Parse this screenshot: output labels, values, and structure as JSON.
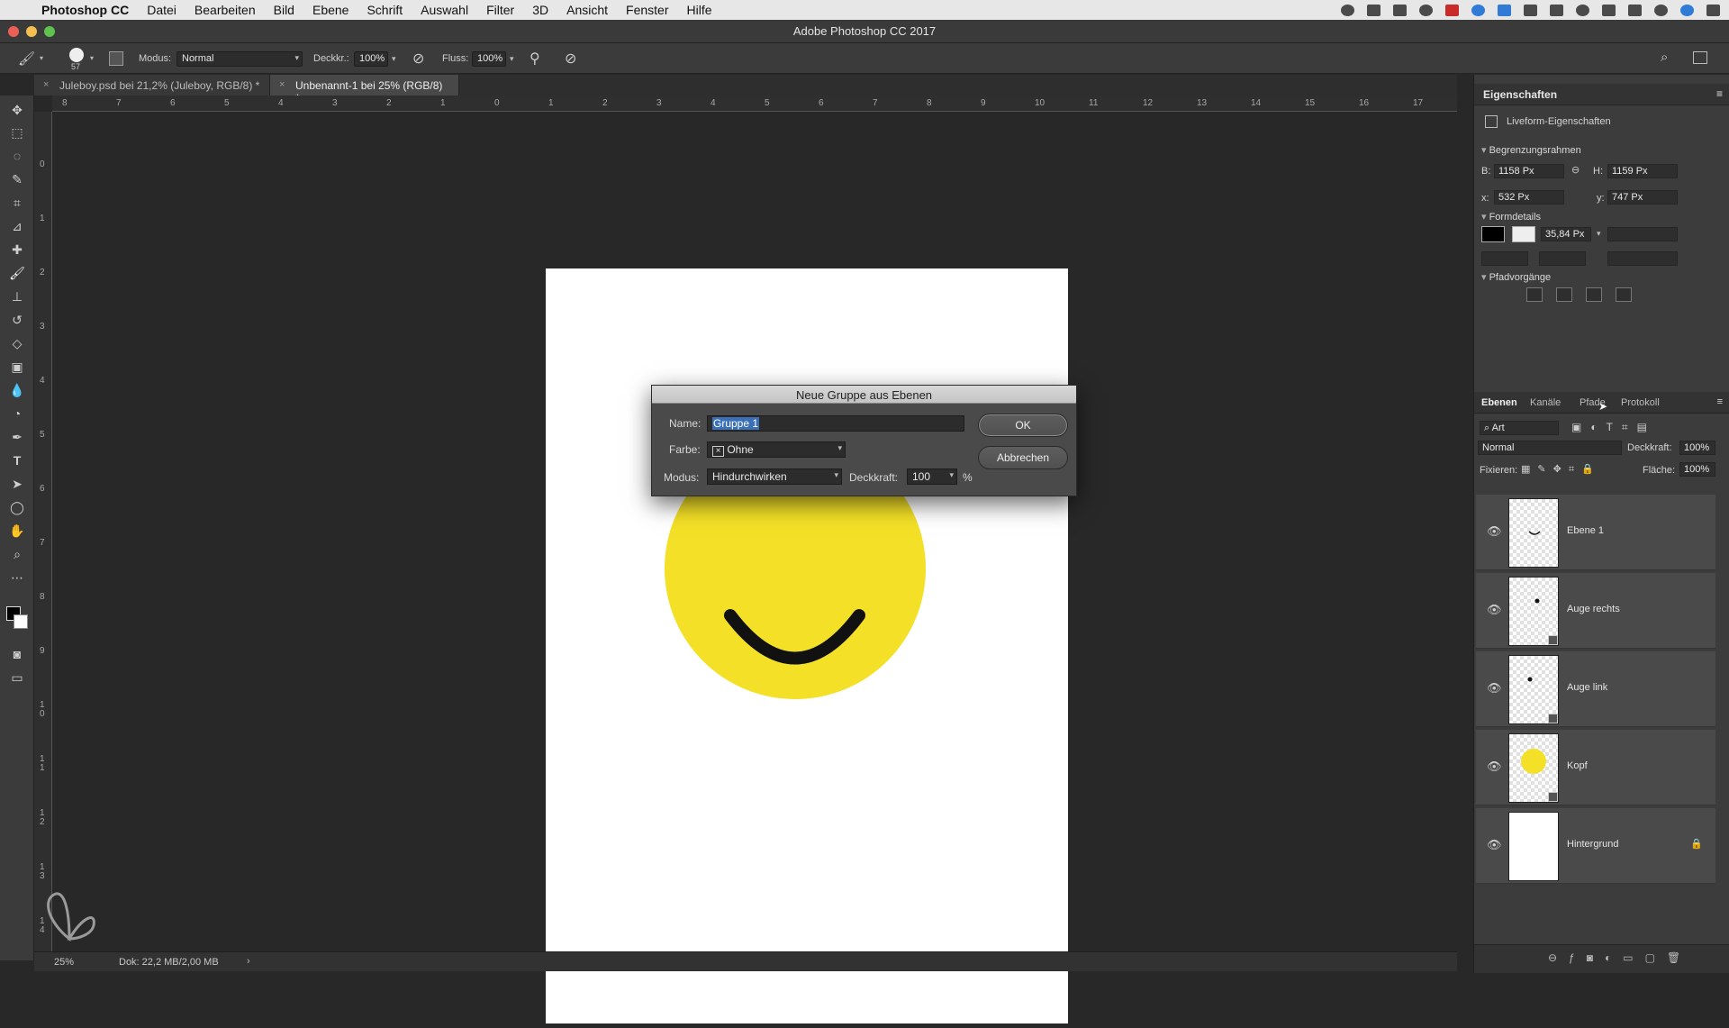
{
  "menubar": {
    "app": "Photoshop CC",
    "items": [
      "Datei",
      "Bearbeiten",
      "Bild",
      "Ebene",
      "Schrift",
      "Auswahl",
      "Filter",
      "3D",
      "Ansicht",
      "Fenster",
      "Hilfe"
    ]
  },
  "window": {
    "title": "Adobe Photoshop CC 2017"
  },
  "options": {
    "brush_size": "57",
    "mode_label": "Modus:",
    "mode_value": "Normal",
    "opacity_label": "Deckkr.:",
    "opacity_value": "100%",
    "flow_label": "Fluss:",
    "flow_value": "100%"
  },
  "tabs": [
    {
      "label": "Juleboy.psd bei 21,2% (Juleboy, RGB/8) *"
    },
    {
      "label": "Unbenannt-1 bei 25% (RGB/8) *"
    }
  ],
  "rulers": {
    "h": [
      "8",
      "7",
      "6",
      "5",
      "4",
      "3",
      "2",
      "1",
      "0",
      "1",
      "2",
      "3",
      "4",
      "5",
      "6",
      "7",
      "8",
      "9",
      "10",
      "11",
      "12",
      "13",
      "14",
      "15",
      "16",
      "17"
    ],
    "v": [
      "0",
      "1",
      "2",
      "3",
      "4",
      "5",
      "6",
      "7",
      "8",
      "9",
      "1 0",
      "1 1",
      "1 2",
      "1 3",
      "1 4"
    ]
  },
  "status": {
    "zoom": "25%",
    "doc": "Dok: 22,2 MB/2,00 MB"
  },
  "properties": {
    "panel_title": "Eigenschaften",
    "subtitle": "Liveform-Eigenschaften",
    "bounds_section": "Begrenzungsrahmen",
    "w_label": "B:",
    "w_value": "1158 Px",
    "h_label": "H:",
    "h_value": "1159 Px",
    "x_label": "x:",
    "x_value": "532 Px",
    "y_label": "y:",
    "y_value": "747 Px",
    "shape_section": "Formdetails",
    "stroke_width": "35,84 Px",
    "path_section": "Pfadvorgänge"
  },
  "layers_panel": {
    "tabs": [
      "Ebenen",
      "Kanäle",
      "Pfade",
      "Protokoll"
    ],
    "filter_label": "Art",
    "blend_mode": "Normal",
    "opacity_label": "Deckkraft:",
    "opacity_value": "100%",
    "lock_label": "Fixieren:",
    "fill_label": "Fläche:",
    "fill_value": "100%",
    "layers": [
      {
        "name": "Ebene 1"
      },
      {
        "name": "Auge rechts"
      },
      {
        "name": "Auge link"
      },
      {
        "name": "Kopf"
      },
      {
        "name": "Hintergrund"
      }
    ]
  },
  "dialog": {
    "title": "Neue Gruppe aus Ebenen",
    "name_label": "Name:",
    "name_value": "Gruppe 1",
    "color_label": "Farbe:",
    "color_value": "Ohne",
    "mode_label": "Modus:",
    "mode_value": "Hindurchwirken",
    "opacity_label": "Deckkraft:",
    "opacity_value": "100",
    "opacity_unit": "%",
    "ok_label": "OK",
    "cancel_label": "Abbrechen"
  },
  "colors": {
    "smiley_yellow": "#f3e027",
    "selection_blue": "#3b6fb6"
  }
}
